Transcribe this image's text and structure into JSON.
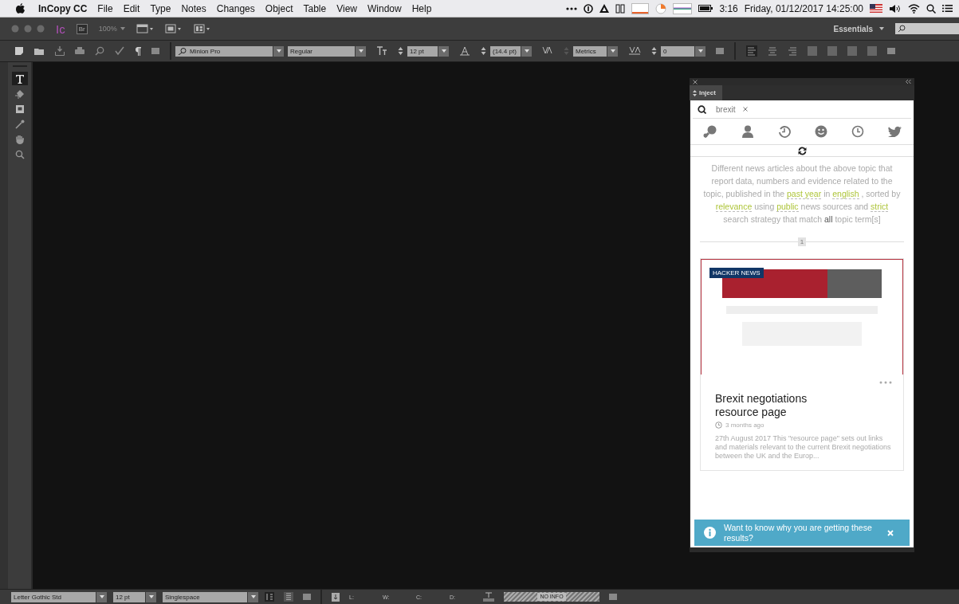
{
  "menubar": {
    "app": "InCopy CC",
    "menus": [
      "File",
      "Edit",
      "Type",
      "Notes",
      "Changes",
      "Object",
      "Table",
      "View",
      "Window",
      "Help"
    ],
    "status": {
      "time": "3:16",
      "datetime": "Friday, 01/12/2017 14:25:00"
    }
  },
  "appbar": {
    "logo": "Ic",
    "bridge": "Br",
    "zoom": "100%",
    "workspace": "Essentials"
  },
  "control_bar": {
    "font": "Minion Pro",
    "style": "Regular",
    "size": "12 pt",
    "leading": "(14.4 pt)",
    "kerning": "Metrics",
    "tracking": "0"
  },
  "tools": [
    {
      "kind": "type",
      "selected": true
    },
    {
      "kind": "note",
      "selected": false
    },
    {
      "kind": "frame",
      "selected": false
    },
    {
      "kind": "eyedropper",
      "selected": false
    },
    {
      "kind": "hand",
      "selected": false
    },
    {
      "kind": "zoom",
      "selected": false
    }
  ],
  "panel": {
    "tab": "Inject",
    "search": {
      "value": "brexit"
    },
    "filters": [
      {
        "kind": "search"
      },
      {
        "kind": "person"
      },
      {
        "kind": "history"
      },
      {
        "kind": "smiley"
      },
      {
        "kind": "clock"
      },
      {
        "kind": "bird"
      }
    ],
    "description": [
      {
        "kind": "text",
        "text": "Different news articles about the above topic that report data, numbers and evidence related to the topic, published in the"
      },
      {
        "kind": "link",
        "text": "past year"
      },
      {
        "kind": "text",
        "text": "in"
      },
      {
        "kind": "link",
        "text": "english"
      },
      {
        "kind": "text",
        "text": ", sorted by"
      },
      {
        "kind": "link",
        "text": "relevance"
      },
      {
        "kind": "text",
        "text": "using"
      },
      {
        "kind": "link",
        "text": "public"
      },
      {
        "kind": "text",
        "text": "news sources and"
      },
      {
        "kind": "link",
        "text": "strict"
      },
      {
        "kind": "text",
        "text": "search strategy that match"
      },
      {
        "kind": "bold",
        "text": "all"
      },
      {
        "kind": "text",
        "text": "topic term[s]"
      }
    ],
    "page": "1",
    "article": {
      "source": "HACKER NEWS",
      "title": "Brexit negotiations resource page",
      "age": "3 months ago",
      "snippet": "27th August 2017 This \"resource page\" sets out links and materials relevant to the current Brexit negotiations between the UK and the Europ..."
    },
    "toast": {
      "text": "Want to know why you are getting these results?"
    }
  },
  "status_bar": {
    "font": "Letter Gothic Std",
    "size": "12 pt",
    "spacing": "Singlespace",
    "fields": [
      "L:",
      "W:",
      "C:",
      "D:"
    ],
    "info": "NO INFO"
  }
}
